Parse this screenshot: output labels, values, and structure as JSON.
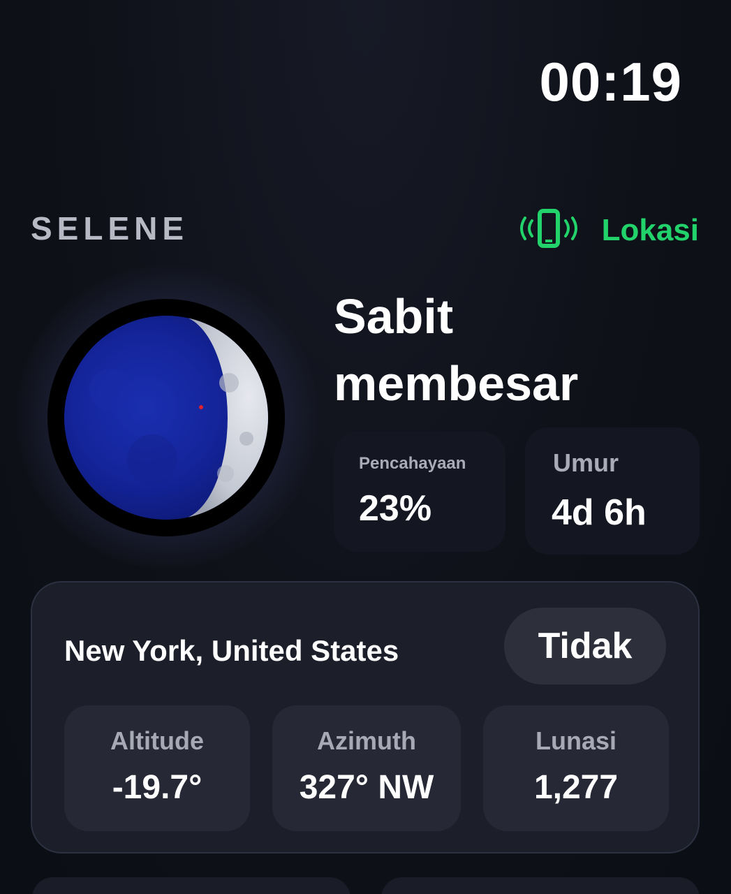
{
  "status": {
    "time": "00:19"
  },
  "header": {
    "brand": "SELENE",
    "location_label": "Lokasi",
    "location_icon": "phone-vibrate-icon",
    "accent_color": "#22d26a"
  },
  "moon": {
    "phase_name": "Sabit membesar",
    "illumination": 0.23,
    "illumination_label": "Pencahayaan",
    "illumination_value": "23%",
    "age_label": "Umur",
    "age_value": "4d 6h"
  },
  "observer": {
    "location": "New York, United States",
    "toggle_label": "Tidak",
    "metrics": [
      {
        "label": "Altitude",
        "value": "-19.7°"
      },
      {
        "label": "Azimuth",
        "value": "327° NW"
      },
      {
        "label": "Lunasi",
        "value": "1,277"
      }
    ]
  }
}
